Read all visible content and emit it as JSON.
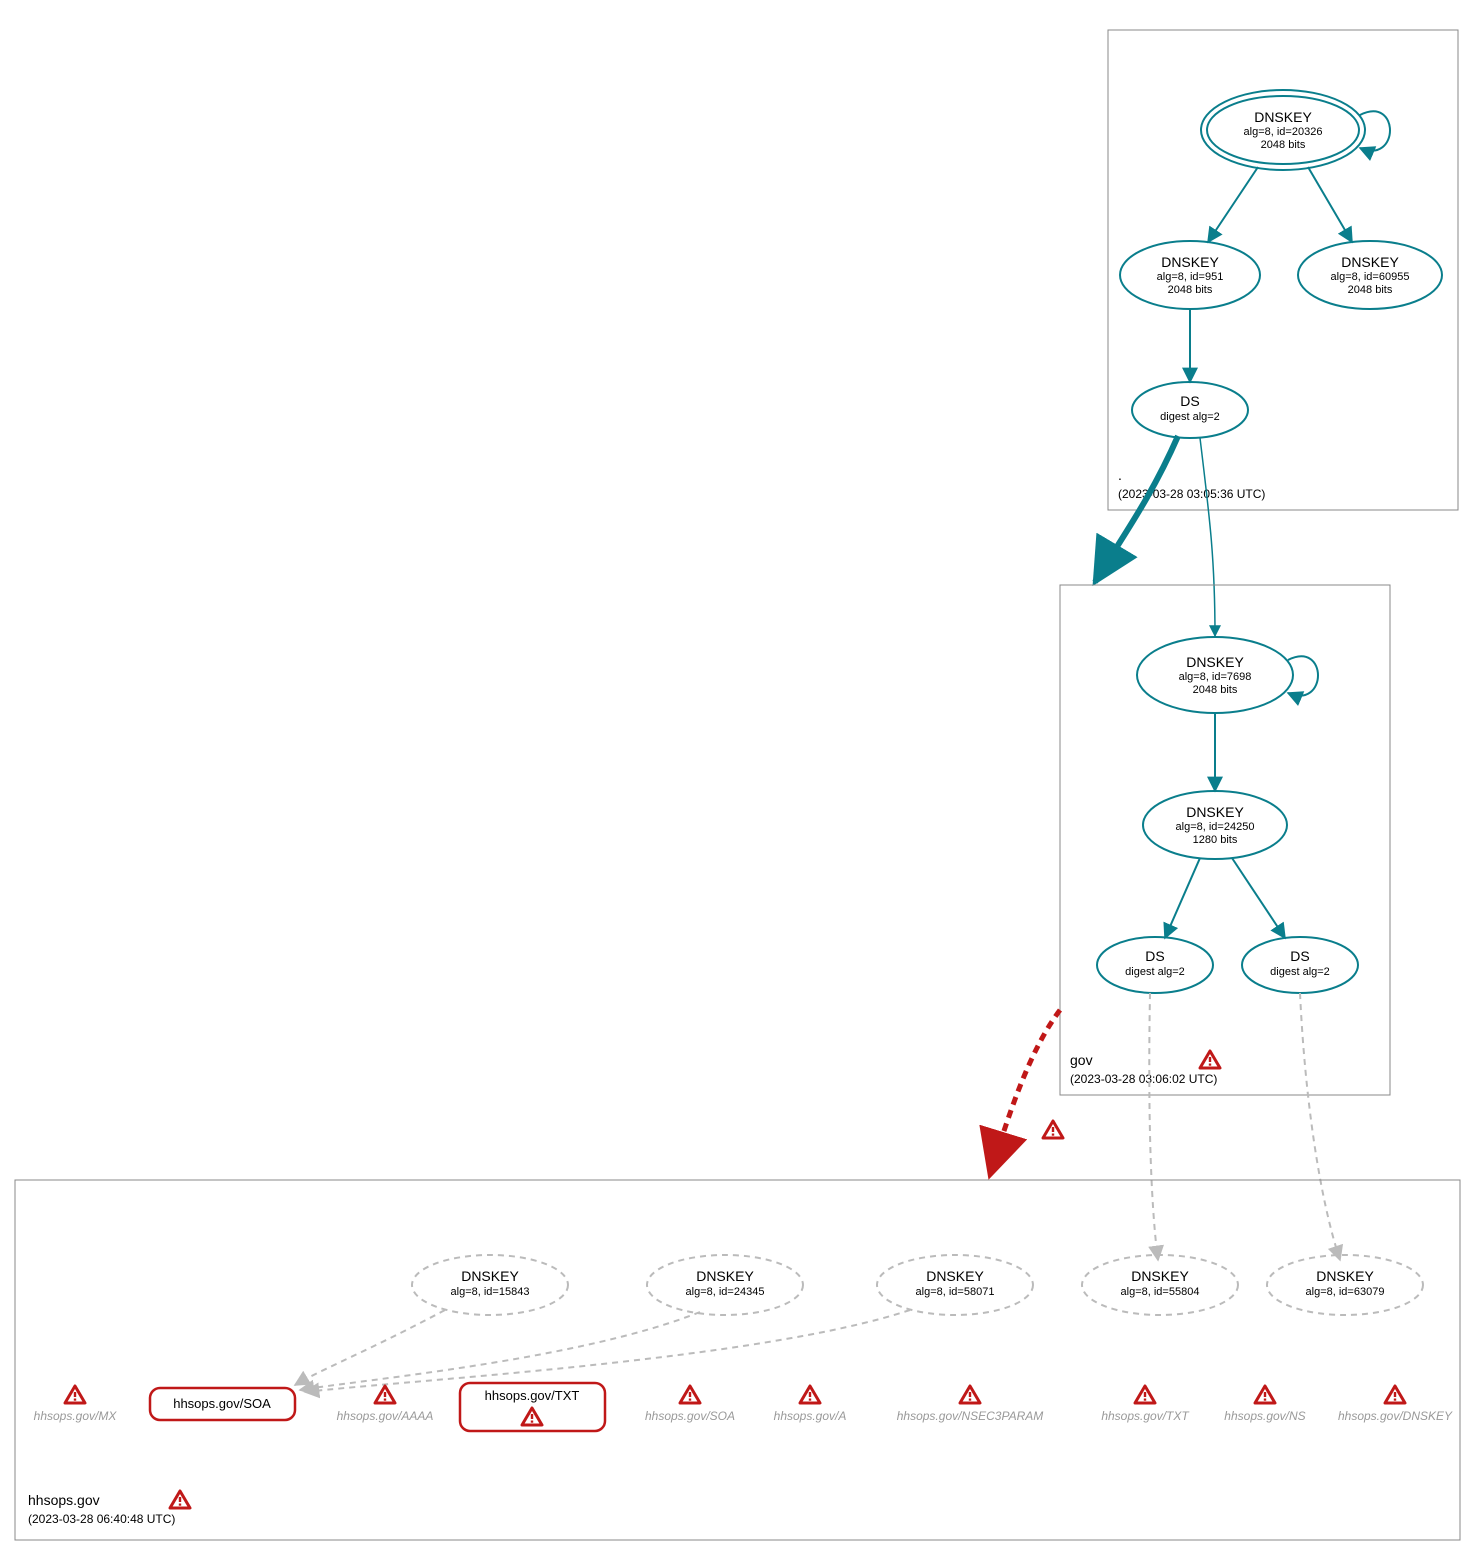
{
  "zones": {
    "root": {
      "name": ".",
      "timestamp": "(2023-03-28 03:05:36 UTC)",
      "nodes": {
        "ksk": {
          "title": "DNSKEY",
          "line2": "alg=8, id=20326",
          "line3": "2048 bits"
        },
        "zsk1": {
          "title": "DNSKEY",
          "line2": "alg=8, id=951",
          "line3": "2048 bits"
        },
        "zsk2": {
          "title": "DNSKEY",
          "line2": "alg=8, id=60955",
          "line3": "2048 bits"
        },
        "ds": {
          "title": "DS",
          "line2": "digest alg=2"
        }
      }
    },
    "gov": {
      "name": "gov",
      "timestamp": "(2023-03-28 03:06:02 UTC)",
      "nodes": {
        "ksk": {
          "title": "DNSKEY",
          "line2": "alg=8, id=7698",
          "line3": "2048 bits"
        },
        "zsk": {
          "title": "DNSKEY",
          "line2": "alg=8, id=24250",
          "line3": "1280 bits"
        },
        "ds1": {
          "title": "DS",
          "line2": "digest alg=2"
        },
        "ds2": {
          "title": "DS",
          "line2": "digest alg=2"
        }
      }
    },
    "hhsops": {
      "name": "hhsops.gov",
      "timestamp": "(2023-03-28 06:40:48 UTC)",
      "dnskeys": {
        "k1": {
          "title": "DNSKEY",
          "line2": "alg=8, id=15843"
        },
        "k2": {
          "title": "DNSKEY",
          "line2": "alg=8, id=24345"
        },
        "k3": {
          "title": "DNSKEY",
          "line2": "alg=8, id=58071"
        },
        "k4": {
          "title": "DNSKEY",
          "line2": "alg=8, id=55804"
        },
        "k5": {
          "title": "DNSKEY",
          "line2": "alg=8, id=63079"
        }
      },
      "rrsets_boxed": {
        "soa": "hhsops.gov/SOA",
        "txt": "hhsops.gov/TXT"
      },
      "rrsets_grey": {
        "mx": "hhsops.gov/MX",
        "aaaa": "hhsops.gov/AAAA",
        "soa2": "hhsops.gov/SOA",
        "a": "hhsops.gov/A",
        "nsec3param": "hhsops.gov/NSEC3PARAM",
        "txt2": "hhsops.gov/TXT",
        "ns": "hhsops.gov/NS",
        "dnskey": "hhsops.gov/DNSKEY"
      }
    }
  }
}
